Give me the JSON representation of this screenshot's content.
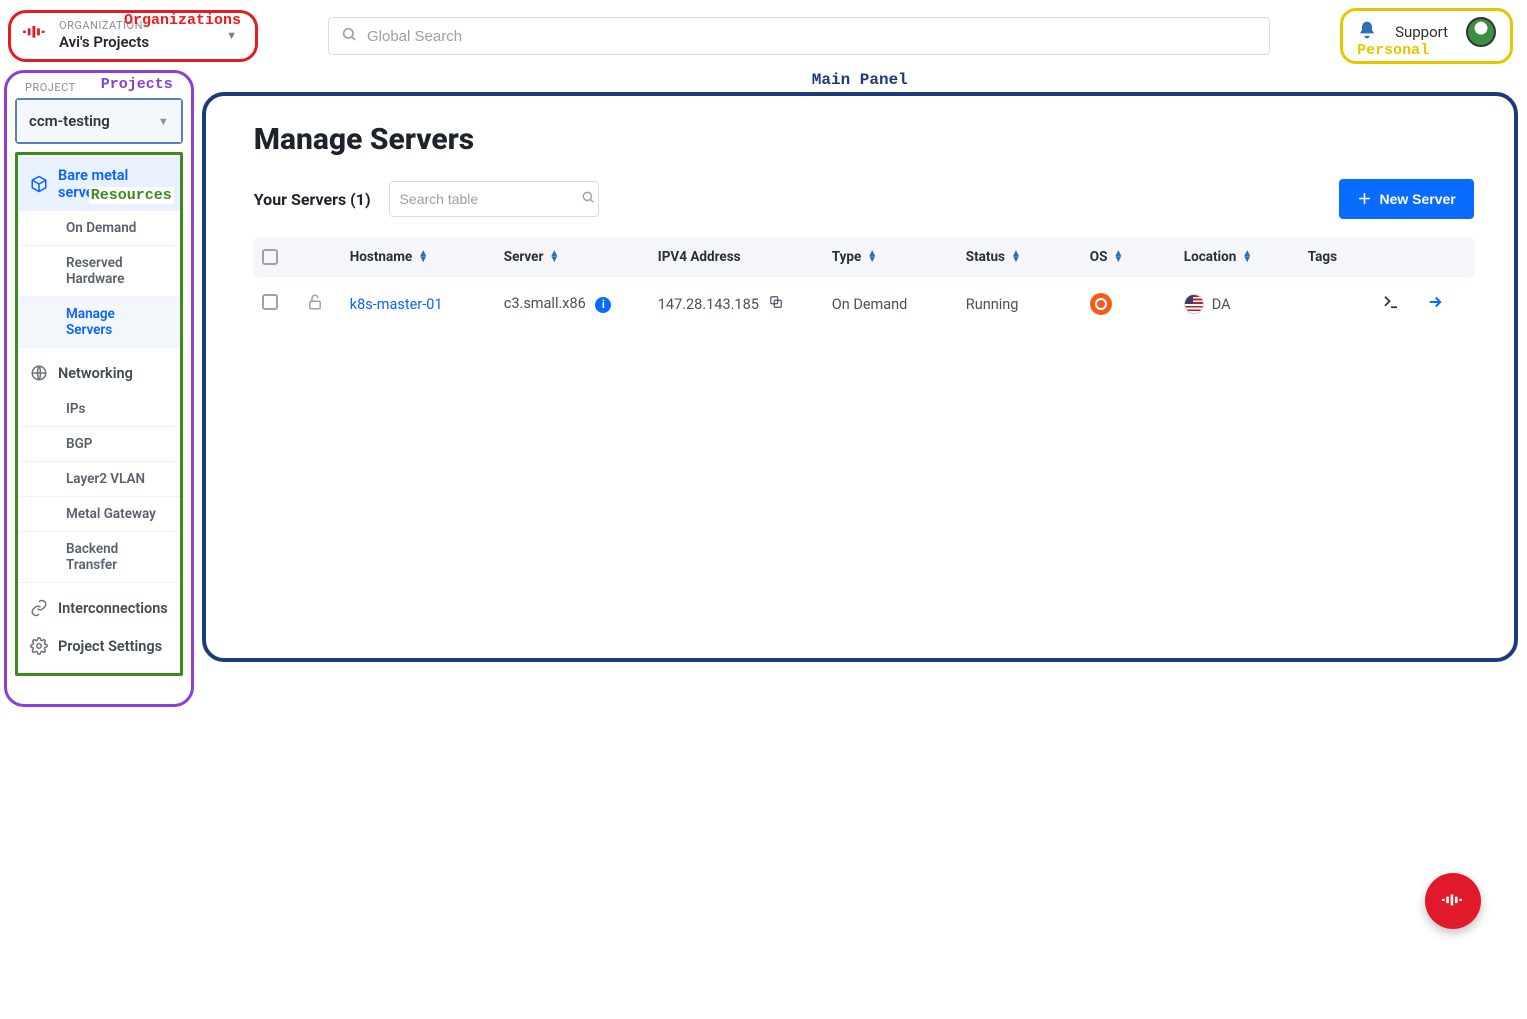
{
  "annotations": {
    "organizations": "Organizations",
    "projects": "Projects",
    "resources": "Resources",
    "personal": "Personal",
    "main_panel": "Main Panel"
  },
  "header": {
    "org_label": "ORGANIZATION",
    "org_name": "Avi's Projects",
    "search_placeholder": "Global Search",
    "support": "Support"
  },
  "project": {
    "label": "PROJECT",
    "name": "ccm-testing"
  },
  "sidebar": {
    "bare_metal": "Bare metal servers",
    "bm_items": [
      "On Demand",
      "Reserved Hardware",
      "Manage Servers"
    ],
    "networking": "Networking",
    "net_items": [
      "IPs",
      "BGP",
      "Layer2 VLAN",
      "Metal Gateway",
      "Backend Transfer"
    ],
    "interconnections": "Interconnections",
    "project_settings": "Project Settings"
  },
  "main": {
    "title": "Manage Servers",
    "count_label": "Your Servers (1)",
    "search_placeholder": "Search table",
    "new_server": "New Server",
    "columns": {
      "hostname": "Hostname",
      "server": "Server",
      "ipv4": "IPV4 Address",
      "type": "Type",
      "status": "Status",
      "os": "OS",
      "location": "Location",
      "tags": "Tags"
    },
    "rows": [
      {
        "hostname": "k8s-master-01",
        "server": "c3.small.x86",
        "ipv4": "147.28.143.185",
        "type": "On Demand",
        "status": "Running",
        "os": "ubuntu",
        "location": "DA",
        "tags": ""
      }
    ]
  }
}
